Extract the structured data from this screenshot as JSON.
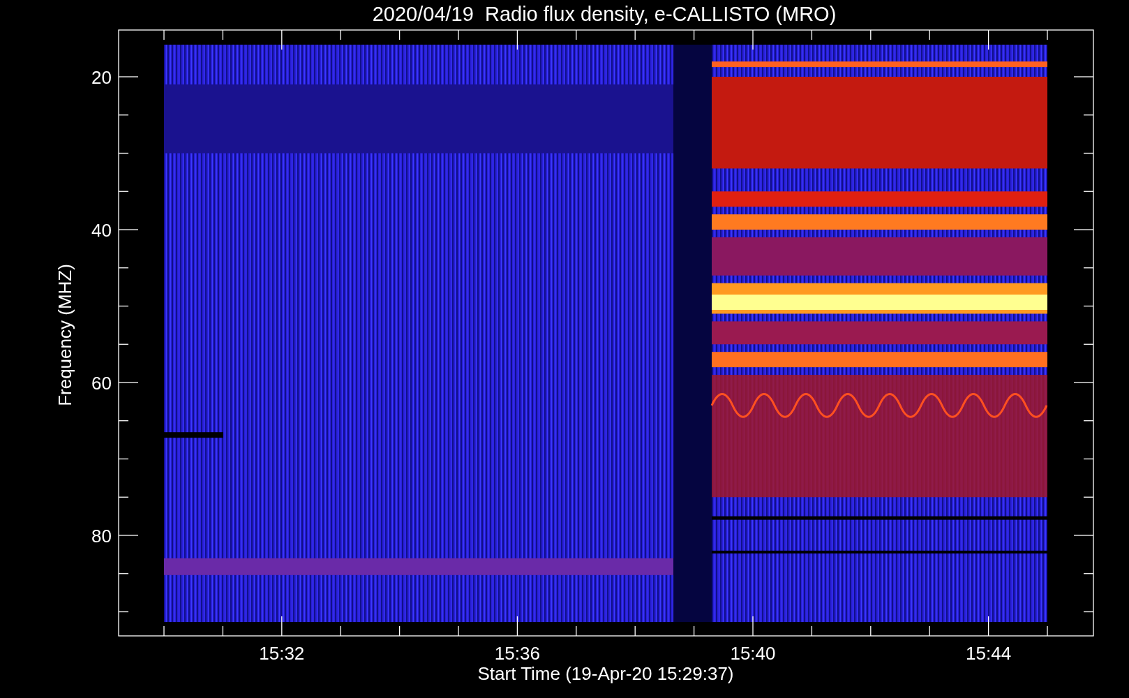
{
  "title": "2020/04/19  Radio flux density, e-CALLISTO (MRO)",
  "y_axis": {
    "label": "Frequency (MHZ)",
    "ticks": [
      "20",
      "40",
      "60",
      "80"
    ]
  },
  "x_axis": {
    "label": "Start Time (19-Apr-20 15:29:37)",
    "ticks": [
      "15:32",
      "15:36",
      "15:40",
      "15:44"
    ]
  }
}
